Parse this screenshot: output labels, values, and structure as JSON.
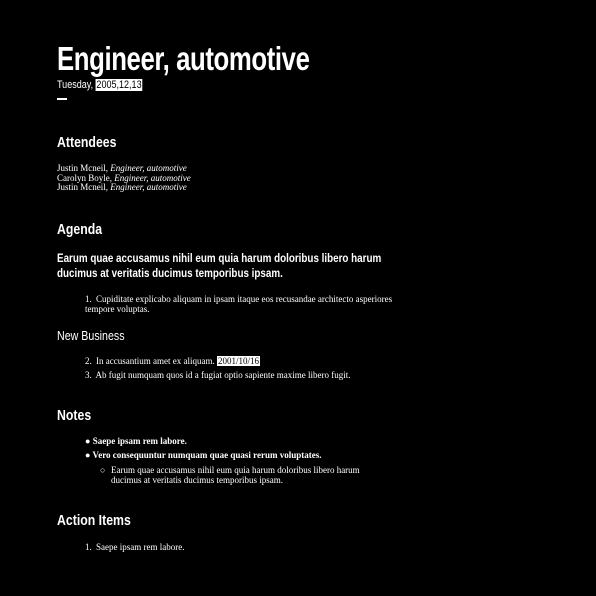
{
  "title": "Engineer, automotive",
  "date": {
    "weekday": "Tuesday,",
    "value": "2005,12,13"
  },
  "attendees": {
    "heading": "Attendees",
    "list": [
      {
        "name": "Justin Mcneil,",
        "role": "Engineer, automotive"
      },
      {
        "name": "Carolyn Boyle,",
        "role": "Engineer, automotive"
      },
      {
        "name": "Justin Mcneil,",
        "role": "Engineer, automotive"
      }
    ]
  },
  "agenda": {
    "heading": "Agenda",
    "topic": "Earum quae accusamus nihil eum quia harum doloribus libero harum ducimus at veritatis ducimus temporibus ipsam.",
    "items": [
      {
        "num": "1.",
        "text": "Cupiditate explicabo aliquam in ipsam itaque eos recusandae architecto asperiores tempore voluptas."
      }
    ]
  },
  "new_business": {
    "heading": "New Business",
    "items": [
      {
        "num": "2.",
        "text": "In accusantium amet ex aliquam.",
        "date": "2001/10/16"
      },
      {
        "num": "3.",
        "text": "Ab fugit numquam quos id a fugiat optio sapiente maxime libero fugit."
      }
    ]
  },
  "notes": {
    "heading": "Notes",
    "items": [
      "Saepe ipsam rem labore.",
      "Vero consequuntur numquam quae quasi rerum voluptates."
    ],
    "sub_items": [
      "Earum quae accusamus nihil eum quia harum doloribus libero harum ducimus at veritatis ducimus temporibus ipsam."
    ]
  },
  "action_items": {
    "heading": "Action Items",
    "items": [
      {
        "num": "1.",
        "text": "Saepe ipsam rem labore."
      }
    ]
  }
}
